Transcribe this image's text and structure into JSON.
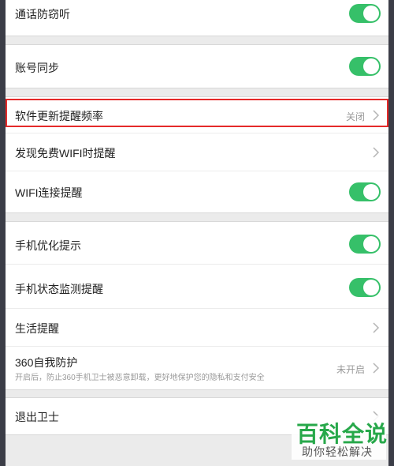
{
  "settings": {
    "call_protection": {
      "label": "通话防窃听",
      "enabled": true
    },
    "account_sync": {
      "label": "账号同步",
      "enabled": true
    },
    "update_reminder_frequency": {
      "label": "软件更新提醒频率",
      "value": "关闭"
    },
    "free_wifi_reminder": {
      "label": "发现免费WIFI时提醒"
    },
    "wifi_connect_reminder": {
      "label": "WIFI连接提醒",
      "enabled": true
    },
    "phone_optimize_tips": {
      "label": "手机优化提示",
      "enabled": true
    },
    "phone_status_monitor": {
      "label": "手机状态监测提醒",
      "enabled": true
    },
    "life_reminder": {
      "label": "生活提醒"
    },
    "self_protect": {
      "label": "360自我防护",
      "description": "开启后，防止360手机卫士被恶意卸载，更好地保护您的隐私和支付安全",
      "value": "未开启"
    },
    "exit": {
      "label": "退出卫士"
    }
  },
  "watermark": {
    "title": "百科全说",
    "subtitle": "助你轻松解决"
  },
  "icons": {
    "chevron": "chevron-right-icon",
    "toggle": "toggle-switch"
  },
  "colors": {
    "toggle_on": "#36c069",
    "highlight": "#e52a2a",
    "watermark_green": "#27a84a"
  }
}
